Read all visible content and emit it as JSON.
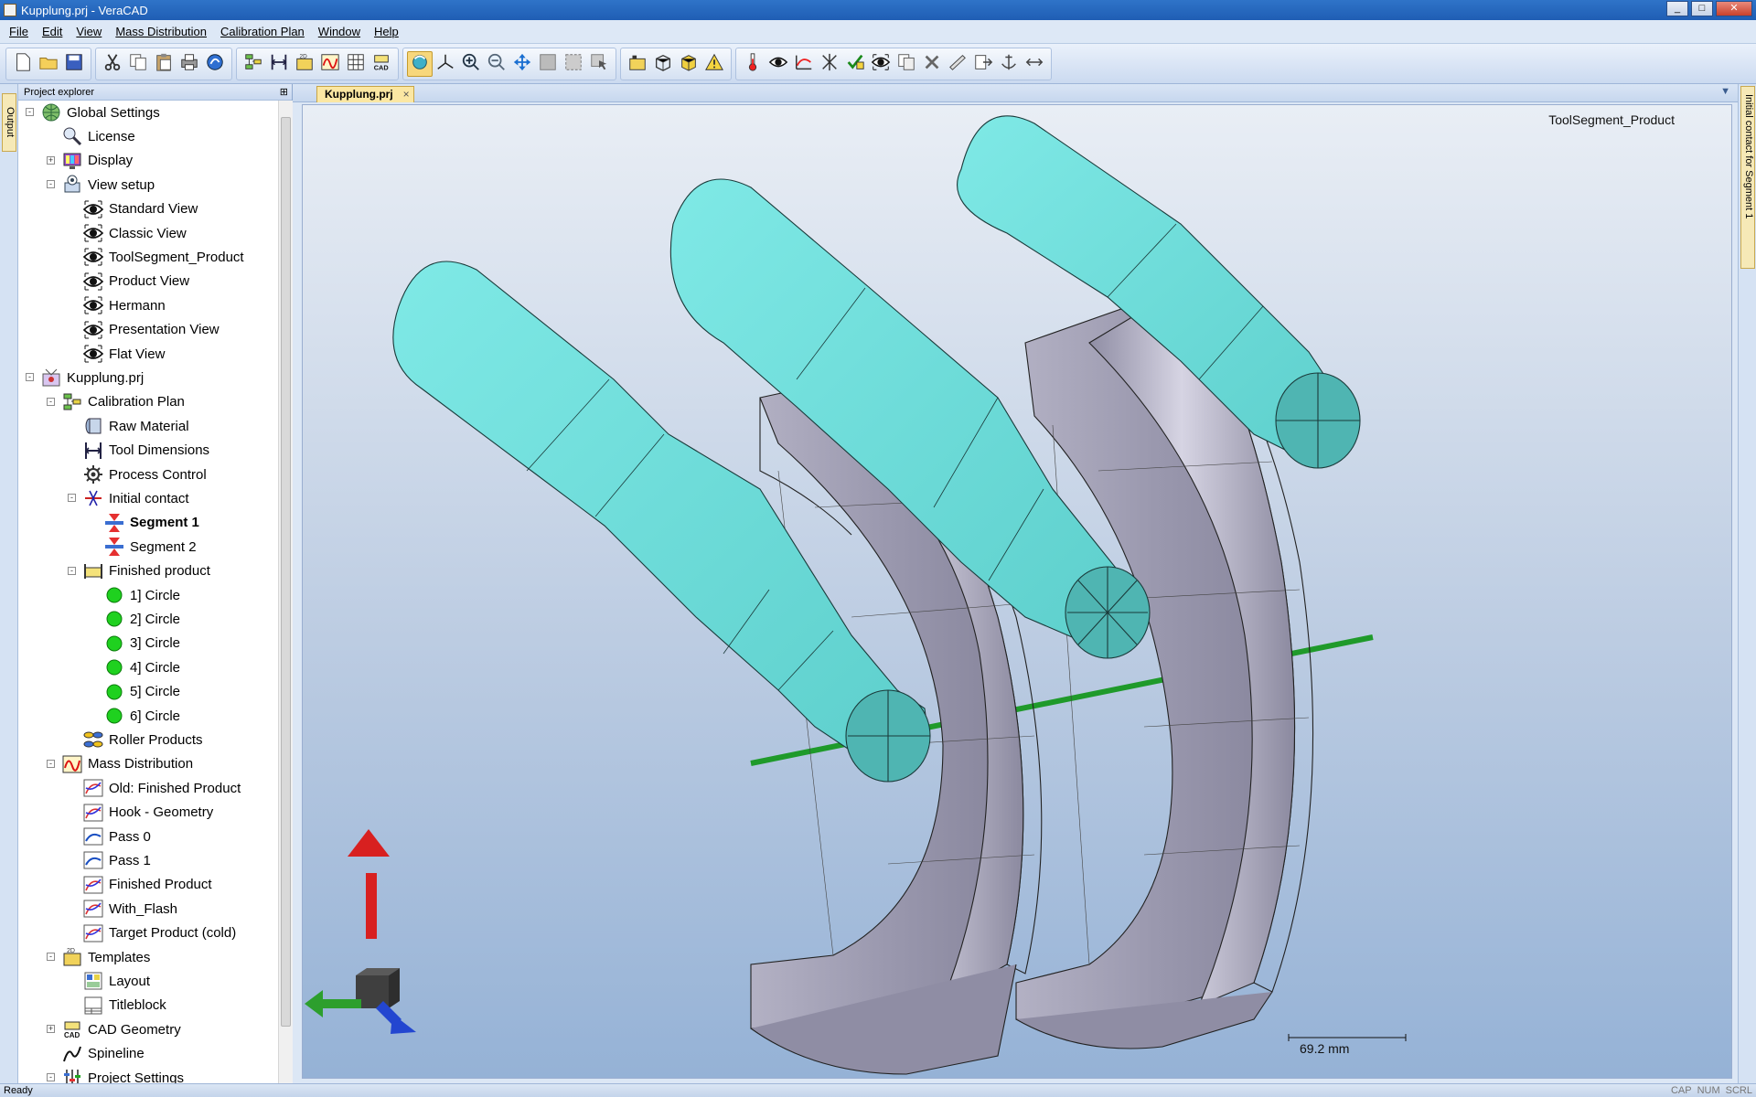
{
  "window": {
    "title": "Kupplung.prj - VeraCAD"
  },
  "menu": [
    "File",
    "Edit",
    "View",
    "Mass Distribution",
    "Calibration Plan",
    "Window",
    "Help"
  ],
  "left_strip": {
    "tab_label": "Output"
  },
  "right_strip": {
    "tab_label": "Initial contact for Segment 1"
  },
  "explorer": {
    "title": "Project explorer",
    "items": [
      {
        "label": "Global Settings",
        "icon": "globe-icon",
        "level": 0,
        "expander": "-"
      },
      {
        "label": "License",
        "icon": "magnifier-key-icon",
        "level": 1,
        "expander": ""
      },
      {
        "label": "Display",
        "icon": "display-icon",
        "level": 1,
        "expander": "+"
      },
      {
        "label": "View setup",
        "icon": "view-setup-icon",
        "level": 1,
        "expander": "-"
      },
      {
        "label": "Standard View",
        "icon": "eye-icon",
        "level": 2,
        "expander": ""
      },
      {
        "label": "Classic View",
        "icon": "eye-icon",
        "level": 2,
        "expander": ""
      },
      {
        "label": "ToolSegment_Product",
        "icon": "eye-icon",
        "level": 2,
        "expander": ""
      },
      {
        "label": "Product View",
        "icon": "eye-icon",
        "level": 2,
        "expander": ""
      },
      {
        "label": "Hermann",
        "icon": "eye-icon",
        "level": 2,
        "expander": ""
      },
      {
        "label": "Presentation View",
        "icon": "eye-icon",
        "level": 2,
        "expander": ""
      },
      {
        "label": "Flat View",
        "icon": "eye-icon",
        "level": 2,
        "expander": ""
      },
      {
        "label": "Kupplung.prj",
        "icon": "project-icon",
        "level": 0,
        "expander": "-"
      },
      {
        "label": "Calibration Plan",
        "icon": "calibration-plan-icon",
        "level": 1,
        "expander": "-"
      },
      {
        "label": "Raw Material",
        "icon": "raw-material-icon",
        "level": 2,
        "expander": ""
      },
      {
        "label": "Tool Dimensions",
        "icon": "tool-dimensions-icon",
        "level": 2,
        "expander": ""
      },
      {
        "label": "Process Control",
        "icon": "gear-icon",
        "level": 2,
        "expander": ""
      },
      {
        "label": "Initial contact",
        "icon": "initial-contact-icon",
        "level": 2,
        "expander": "-"
      },
      {
        "label": "Segment 1",
        "icon": "segment-icon",
        "level": 3,
        "expander": "",
        "bold": true
      },
      {
        "label": "Segment 2",
        "icon": "segment-icon",
        "level": 3,
        "expander": ""
      },
      {
        "label": "Finished product",
        "icon": "finished-product-icon",
        "level": 2,
        "expander": "-"
      },
      {
        "label": "1] Circle",
        "icon": "green-circle-icon",
        "level": 3,
        "expander": ""
      },
      {
        "label": "2] Circle",
        "icon": "green-circle-icon",
        "level": 3,
        "expander": ""
      },
      {
        "label": "3] Circle",
        "icon": "green-circle-icon",
        "level": 3,
        "expander": ""
      },
      {
        "label": "4] Circle",
        "icon": "green-circle-icon",
        "level": 3,
        "expander": ""
      },
      {
        "label": "5] Circle",
        "icon": "green-circle-icon",
        "level": 3,
        "expander": ""
      },
      {
        "label": "6] Circle",
        "icon": "green-circle-icon",
        "level": 3,
        "expander": ""
      },
      {
        "label": "Roller Products",
        "icon": "roller-products-icon",
        "level": 2,
        "expander": ""
      },
      {
        "label": "Mass Distribution",
        "icon": "mass-distribution-icon",
        "level": 1,
        "expander": "-"
      },
      {
        "label": "Old: Finished Product",
        "icon": "curve-icon",
        "level": 2,
        "expander": ""
      },
      {
        "label": "Hook - Geometry",
        "icon": "curve-icon",
        "level": 2,
        "expander": ""
      },
      {
        "label": "Pass 0",
        "icon": "pass-icon",
        "level": 2,
        "expander": ""
      },
      {
        "label": "Pass 1",
        "icon": "pass-icon",
        "level": 2,
        "expander": ""
      },
      {
        "label": "Finished Product",
        "icon": "curve-icon",
        "level": 2,
        "expander": ""
      },
      {
        "label": "With_Flash",
        "icon": "curve-icon",
        "level": 2,
        "expander": ""
      },
      {
        "label": "Target Product (cold)",
        "icon": "curve-icon",
        "level": 2,
        "expander": ""
      },
      {
        "label": "Templates",
        "icon": "templates-icon",
        "level": 1,
        "expander": "-"
      },
      {
        "label": "Layout",
        "icon": "layout-icon",
        "level": 2,
        "expander": ""
      },
      {
        "label": "Titleblock",
        "icon": "titleblock-icon",
        "level": 2,
        "expander": ""
      },
      {
        "label": "CAD Geometry",
        "icon": "cad-icon",
        "level": 1,
        "expander": "+"
      },
      {
        "label": "Spineline",
        "icon": "spineline-icon",
        "level": 1,
        "expander": ""
      },
      {
        "label": "Project Settings",
        "icon": "settings-icon",
        "level": 1,
        "expander": "-"
      }
    ]
  },
  "document": {
    "tab_label": "Kupplung.prj",
    "tab_close": "×",
    "menu_arrow": "▼",
    "view_name": "ToolSegment_Product",
    "scale_label": "69.2 mm"
  },
  "toolbar": {
    "groups": [
      [
        "new-file-icon",
        "open-folder-icon",
        "save-icon"
      ],
      [
        "cut-icon",
        "copy-icon",
        "paste-icon",
        "print-icon",
        "help-icon"
      ],
      [
        "calibration-plan-icon",
        "tool-dimensions-icon",
        "templates-icon",
        "mass-distribution-icon",
        "table-icon",
        "cad-icon"
      ],
      [
        "rotate-icon",
        "axes-icon",
        "zoom-in-icon",
        "zoom-out-icon",
        "pan-icon",
        "select-box-icon",
        "select-region-icon",
        "select-arrow-icon"
      ],
      [
        "view-2d-icon",
        "wireframe-cube-icon",
        "solid-cube-icon",
        "warning-icon"
      ],
      [
        "thermometer-icon",
        "eye-menu-icon",
        "chart-icon",
        "cross-icon",
        "check-icon",
        "eye-icon",
        "copy-list-icon",
        "delete-icon",
        "measure-icon",
        "export-icon",
        "anchor-icon",
        "settings-arrows-icon"
      ]
    ]
  },
  "statusbar": {
    "text": "Ready",
    "indicators": [
      "CAP",
      "NUM",
      "SCRL"
    ]
  },
  "window_buttons": [
    "_",
    "□",
    "✕"
  ]
}
